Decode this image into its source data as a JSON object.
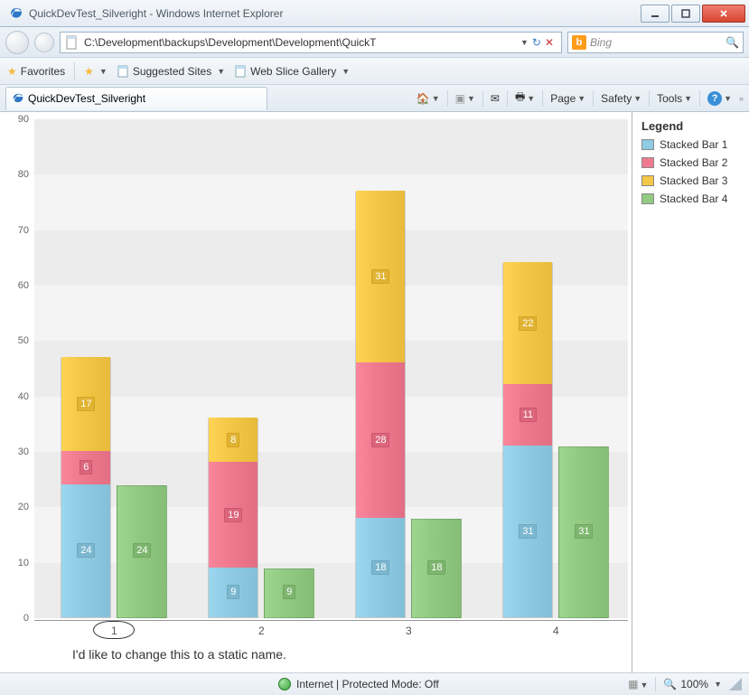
{
  "window": {
    "title": "QuickDevTest_Silveright - Windows Internet Explorer",
    "min_tooltip": "Minimize",
    "max_tooltip": "Maximize",
    "close_tooltip": "Close"
  },
  "nav": {
    "back_tooltip": "Back",
    "fwd_tooltip": "Forward",
    "address": "C:\\Development\\backups\\Development\\Development\\QuickT",
    "refresh_tooltip": "Refresh",
    "stop_tooltip": "Stop",
    "search_provider": "Bing",
    "search_placeholder": "Bing"
  },
  "favbar": {
    "favorites": "Favorites",
    "suggested": "Suggested Sites",
    "webslice": "Web Slice Gallery"
  },
  "tab": {
    "label": "QuickDevTest_Silveright"
  },
  "tools": {
    "home": "Home",
    "feeds": "Feeds",
    "mail": "Read mail",
    "print": "Print",
    "page": "Page",
    "safety": "Safety",
    "tools_label": "Tools",
    "help": "Help"
  },
  "legend": {
    "title": "Legend",
    "items": [
      {
        "label": "Stacked Bar 1",
        "color": "#8fcbe3"
      },
      {
        "label": "Stacked Bar 2",
        "color": "#ef7a90"
      },
      {
        "label": "Stacked Bar 3",
        "color": "#f4c747"
      },
      {
        "label": "Stacked Bar 4",
        "color": "#92ca84"
      }
    ]
  },
  "status": {
    "zone": "Internet | Protected Mode: Off",
    "zoom": "100%"
  },
  "annotation": "I'd like to change this to a static name.",
  "chart_data": {
    "type": "bar",
    "categories": [
      "1",
      "2",
      "3",
      "4"
    ],
    "ylim": [
      0,
      90
    ],
    "yticks": [
      0,
      10,
      20,
      30,
      40,
      50,
      60,
      70,
      80,
      90
    ],
    "series_stacked": [
      "Stacked Bar 1",
      "Stacked Bar 2",
      "Stacked Bar 3"
    ],
    "series_side": "Stacked Bar 4",
    "colors": {
      "Stacked Bar 1": "#8fcbe3",
      "Stacked Bar 2": "#ef7a90",
      "Stacked Bar 3": "#f4c747",
      "Stacked Bar 4": "#92ca84"
    },
    "stacked": [
      {
        "s1": 24,
        "s2": 6,
        "s3": 17
      },
      {
        "s1": 9,
        "s2": 19,
        "s3": 8
      },
      {
        "s1": 18,
        "s2": 28,
        "s3": 31
      },
      {
        "s1": 31,
        "s2": 11,
        "s3": 22
      }
    ],
    "side": [
      24,
      9,
      18,
      31
    ]
  }
}
